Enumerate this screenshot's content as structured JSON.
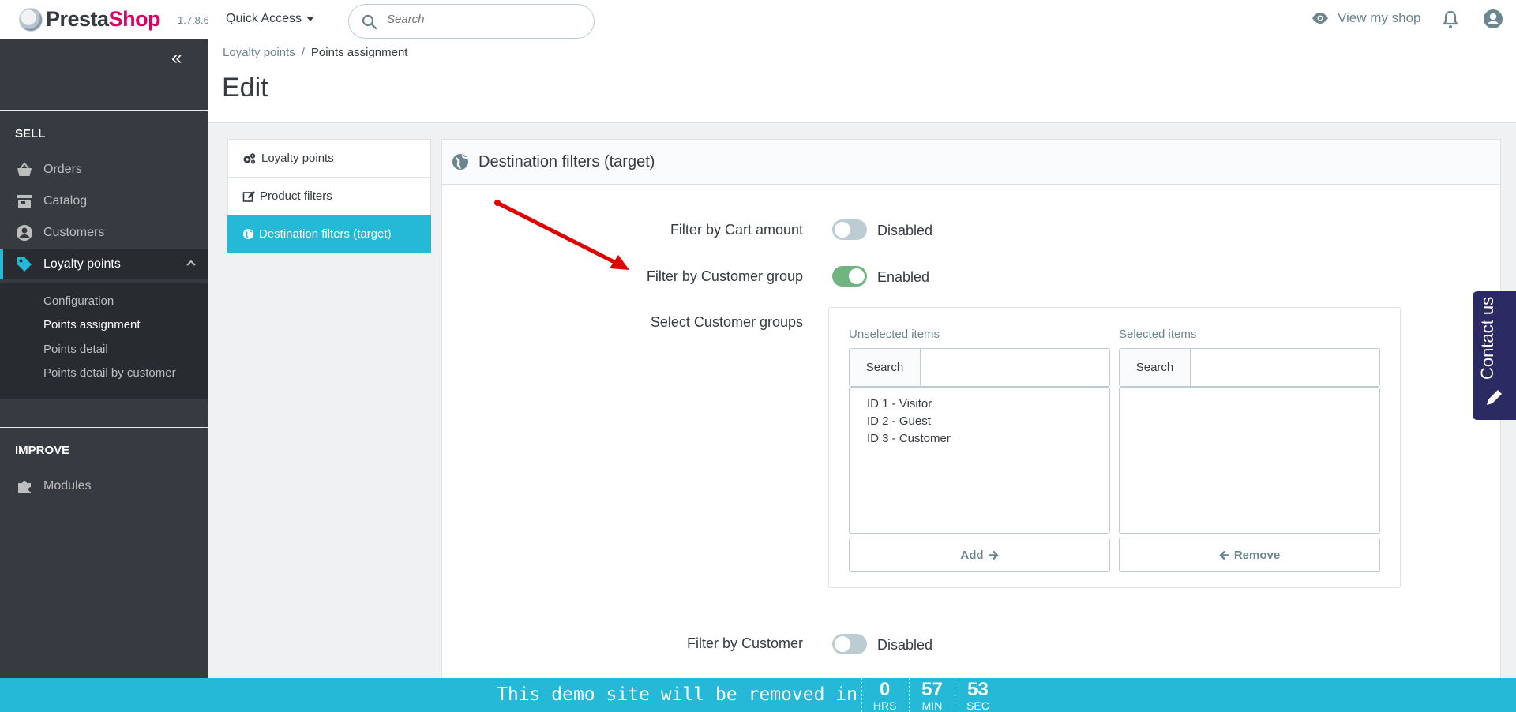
{
  "header": {
    "brand_prefix": "Presta",
    "brand_suffix": "Shop",
    "version": "1.7.8.6",
    "quick_access": "Quick Access",
    "search_placeholder": "Search",
    "view_shop": "View my shop"
  },
  "sidebar": {
    "collapse_icon": "double-chevron-left",
    "sell_title": "SELL",
    "improve_title": "IMPROVE",
    "items": [
      {
        "label": "Orders",
        "icon": "basket-icon"
      },
      {
        "label": "Catalog",
        "icon": "store-icon"
      },
      {
        "label": "Customers",
        "icon": "account-circle-icon"
      },
      {
        "label": "Loyalty points",
        "icon": "tag-icon"
      }
    ],
    "submenu": [
      "Configuration",
      "Points assignment",
      "Points detail",
      "Points detail by customer"
    ],
    "modules": "Modules"
  },
  "breadcrumb": {
    "parent": "Loyalty points",
    "separator": "/",
    "current": "Points assignment"
  },
  "page_title": "Edit",
  "tabs": [
    "Loyalty points",
    "Product filters",
    "Destination filters (target)"
  ],
  "panel": {
    "title": "Destination filters (target)",
    "filter_cart_label": "Filter by Cart amount",
    "filter_cart_state": "Disabled",
    "filter_group_label": "Filter by Customer group",
    "filter_group_state": "Enabled",
    "select_groups_label": "Select Customer groups",
    "unselected_title": "Unselected items",
    "selected_title": "Selected items",
    "search_label": "Search",
    "unselected_items": [
      "ID 1 - Visitor",
      "ID 2 - Guest",
      "ID 3 - Customer"
    ],
    "add_label": "Add",
    "remove_label": "Remove",
    "filter_customer_label": "Filter by Customer",
    "filter_customer_state": "Disabled"
  },
  "contact": "Contact us",
  "demo": {
    "text": "This demo site will be removed in",
    "hrs": "0",
    "hrs_label": "HRS",
    "min": "57",
    "min_label": "MIN",
    "sec": "53",
    "sec_label": "SEC"
  },
  "colors": {
    "accent": "#25b9d7",
    "sidebar": "#363a41",
    "brand": "#df0067",
    "enabled": "#70b580",
    "annotation": "#e00000"
  }
}
